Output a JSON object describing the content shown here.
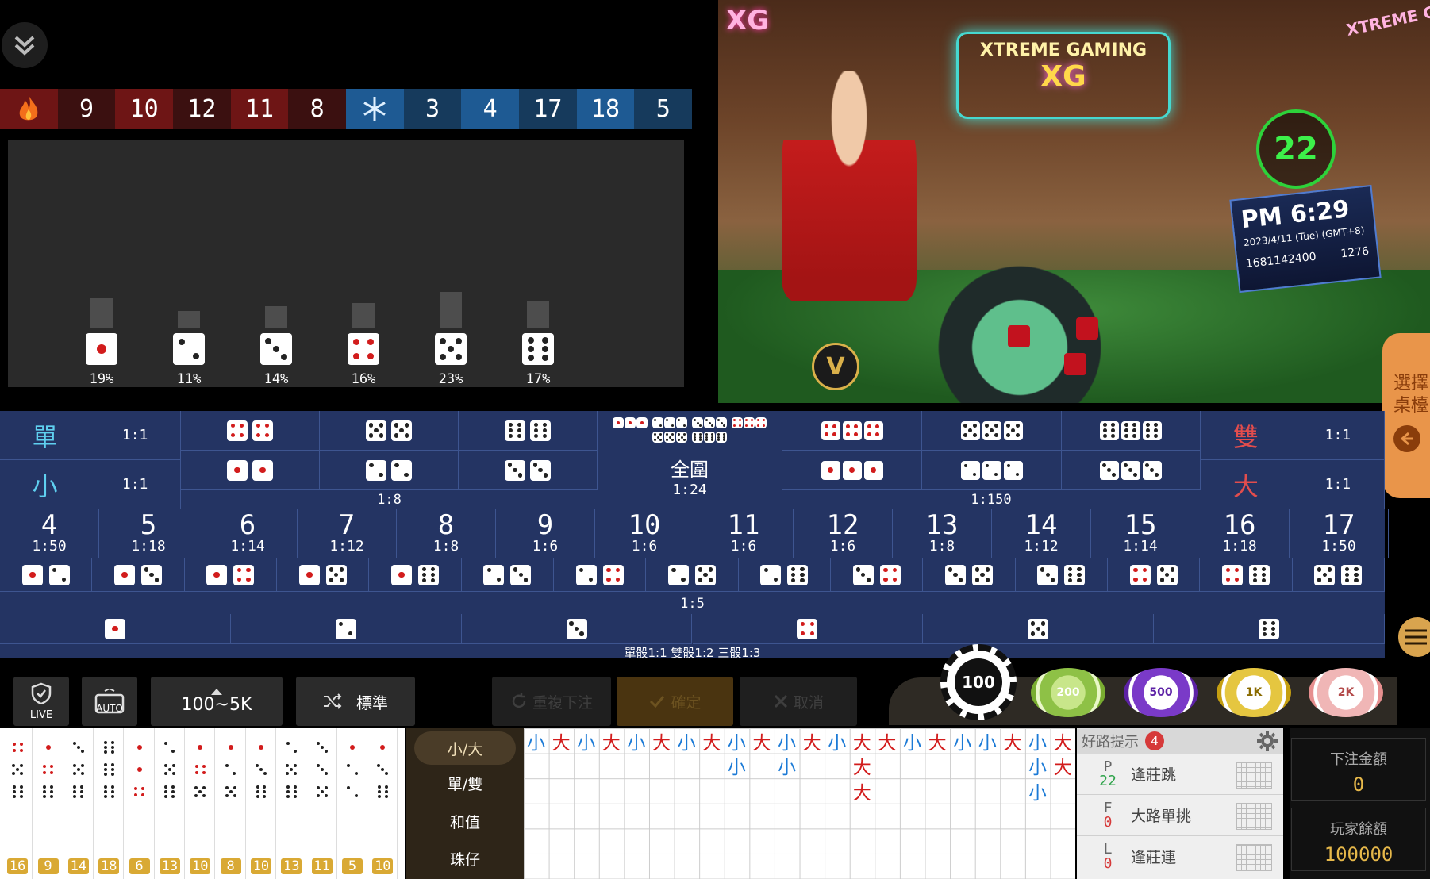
{
  "hot_label": "hot",
  "cold_label": "cold",
  "hot_numbers": [
    "9",
    "10",
    "12",
    "11",
    "8"
  ],
  "cold_numbers": [
    "3",
    "4",
    "17",
    "18",
    "5"
  ],
  "stats": [
    {
      "face": 1,
      "pct": "19%",
      "h": 38
    },
    {
      "face": 2,
      "pct": "11%",
      "h": 22
    },
    {
      "face": 3,
      "pct": "14%",
      "h": 28
    },
    {
      "face": 4,
      "pct": "16%",
      "h": 32
    },
    {
      "face": 5,
      "pct": "23%",
      "h": 46
    },
    {
      "face": 6,
      "pct": "17%",
      "h": 34
    }
  ],
  "video": {
    "countdown": "22",
    "time": "PM 6:29",
    "date": "2023/4/11 (Tue) (GMT+8)",
    "round_id": "1681142400",
    "table_no": "1276",
    "brand": "XTREME GAMING",
    "logo": "XG",
    "brand_right": "XTREME GAMIN"
  },
  "select_table": "選擇桌檯",
  "board": {
    "odd": "單",
    "small": "小",
    "even": "雙",
    "big": "大",
    "one_to_one": "1:1",
    "double_odds": "1:8",
    "triple_any": "全圍",
    "triple_any_odds": "1:24",
    "triple_odds": "1:150",
    "pair_odds": "1:5",
    "single_odds": "單骰1:1 雙骰1:2 三骰1:3",
    "sums": [
      {
        "n": "4",
        "o": "1:50"
      },
      {
        "n": "5",
        "o": "1:18"
      },
      {
        "n": "6",
        "o": "1:14"
      },
      {
        "n": "7",
        "o": "1:12"
      },
      {
        "n": "8",
        "o": "1:8"
      },
      {
        "n": "9",
        "o": "1:6"
      },
      {
        "n": "10",
        "o": "1:6"
      },
      {
        "n": "11",
        "o": "1:6"
      },
      {
        "n": "12",
        "o": "1:6"
      },
      {
        "n": "13",
        "o": "1:8"
      },
      {
        "n": "14",
        "o": "1:12"
      },
      {
        "n": "15",
        "o": "1:14"
      },
      {
        "n": "16",
        "o": "1:18"
      },
      {
        "n": "17",
        "o": "1:50"
      }
    ]
  },
  "controls": {
    "live": "LIVE",
    "auto": "AUTO",
    "limit": "100~5K",
    "mode": "標準",
    "repeat": "重複下注",
    "confirm": "確定",
    "cancel": "取消"
  },
  "chips": [
    "100",
    "200",
    "500",
    "1K",
    "2K"
  ],
  "tabs": [
    "小/大",
    "單/雙",
    "和值",
    "珠仔"
  ],
  "bead_totals": [
    "16",
    "9",
    "14",
    "18",
    "6",
    "13",
    "10",
    "8",
    "10",
    "13",
    "11",
    "5",
    "10"
  ],
  "tips": {
    "title": "好路提示",
    "count": "4",
    "rows": [
      {
        "k": "P",
        "v": "22",
        "label": "逢莊跳"
      },
      {
        "k": "F",
        "v": "0",
        "label": "大路單挑"
      },
      {
        "k": "L",
        "v": "0",
        "label": "逢莊連"
      }
    ]
  },
  "bet_amount_label": "下注金額",
  "bet_amount": "0",
  "balance_label": "玩家餘額",
  "balance": "100000",
  "road_col_0": "小",
  "road_col_1": "大"
}
